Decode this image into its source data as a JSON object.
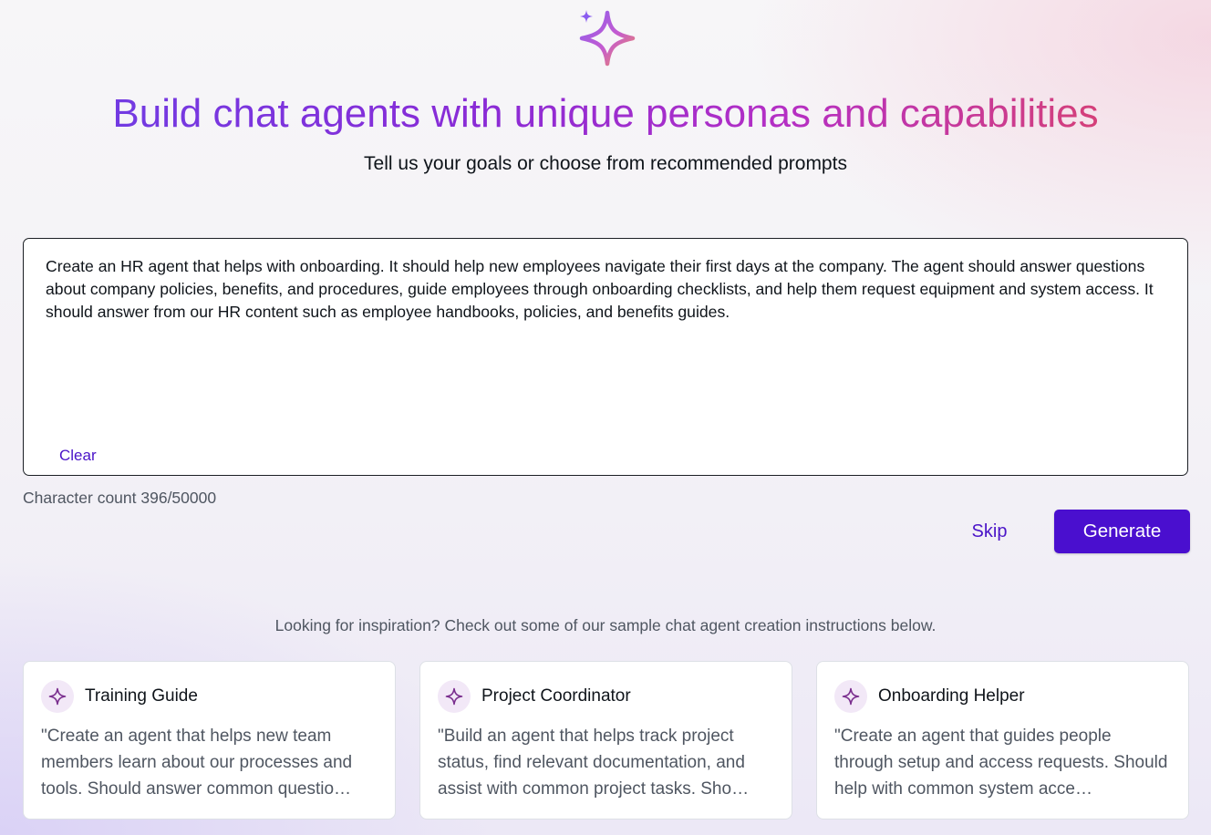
{
  "header": {
    "logo_icon": "sparkle-icon",
    "title": "Build chat agents with unique personas and capabilities",
    "subtitle": "Tell us your goals or choose from recommended prompts"
  },
  "prompt": {
    "value": "Create an HR agent that helps with onboarding. It should help new employees navigate their first days at the company. The agent should answer questions about company policies, benefits, and procedures, guide employees through onboarding checklists, and help them request equipment and system access. It should answer from our HR content such as employee handbooks, policies, and benefits guides.",
    "clear_label": "Clear",
    "character_count": "Character count 396/50000"
  },
  "actions": {
    "skip_label": "Skip",
    "generate_label": "Generate"
  },
  "inspiration": {
    "text": "Looking for inspiration? Check out some of our sample chat agent creation instructions below.",
    "cards": [
      {
        "icon": "sparkle-icon",
        "title": "Training Guide",
        "description": "\"Create an agent that helps new team members learn about our processes and tools. Should answer common questio…"
      },
      {
        "icon": "sparkle-icon",
        "title": "Project Coordinator",
        "description": "\"Build an agent that helps track project status, find relevant documentation, and assist with common project tasks. Sho…"
      },
      {
        "icon": "sparkle-icon",
        "title": "Onboarding Helper",
        "description": "\"Create an agent that guides people through setup and access requests. Should help with common system acce…"
      }
    ]
  },
  "colors": {
    "accent": "#4a0fcf",
    "link": "#4b14c8",
    "title_gradient": [
      "#6b3fe6",
      "#b52fc4",
      "#e0465e"
    ]
  }
}
